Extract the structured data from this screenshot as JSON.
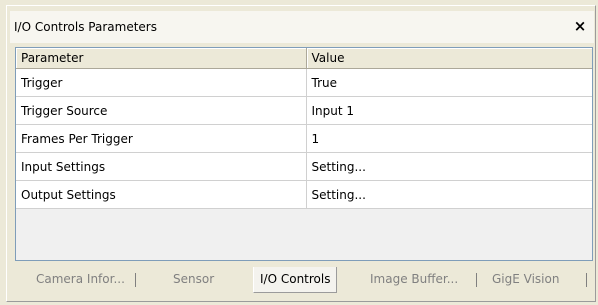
{
  "window": {
    "title": "I/O Controls Parameters",
    "close_glyph": "×"
  },
  "table": {
    "headers": [
      "Parameter",
      "Value"
    ],
    "rows": [
      {
        "parameter": "Trigger",
        "value": "True"
      },
      {
        "parameter": "Trigger Source",
        "value": "Input 1"
      },
      {
        "parameter": "Frames Per Trigger",
        "value": "1"
      },
      {
        "parameter": "Input Settings",
        "value": "Setting..."
      },
      {
        "parameter": "Output Settings",
        "value": "Setting..."
      }
    ]
  },
  "tabs": [
    {
      "label": "Camera Infor...",
      "active": false
    },
    {
      "label": "Sensor",
      "active": false
    },
    {
      "label": "I/O Controls",
      "active": true
    },
    {
      "label": "Image Buffer...",
      "active": false
    },
    {
      "label": "GigE Vision",
      "active": false
    }
  ],
  "colors": {
    "background": "#ece9d8",
    "grid_border": "#7f9db9",
    "inactive_tab_text": "#808080"
  }
}
